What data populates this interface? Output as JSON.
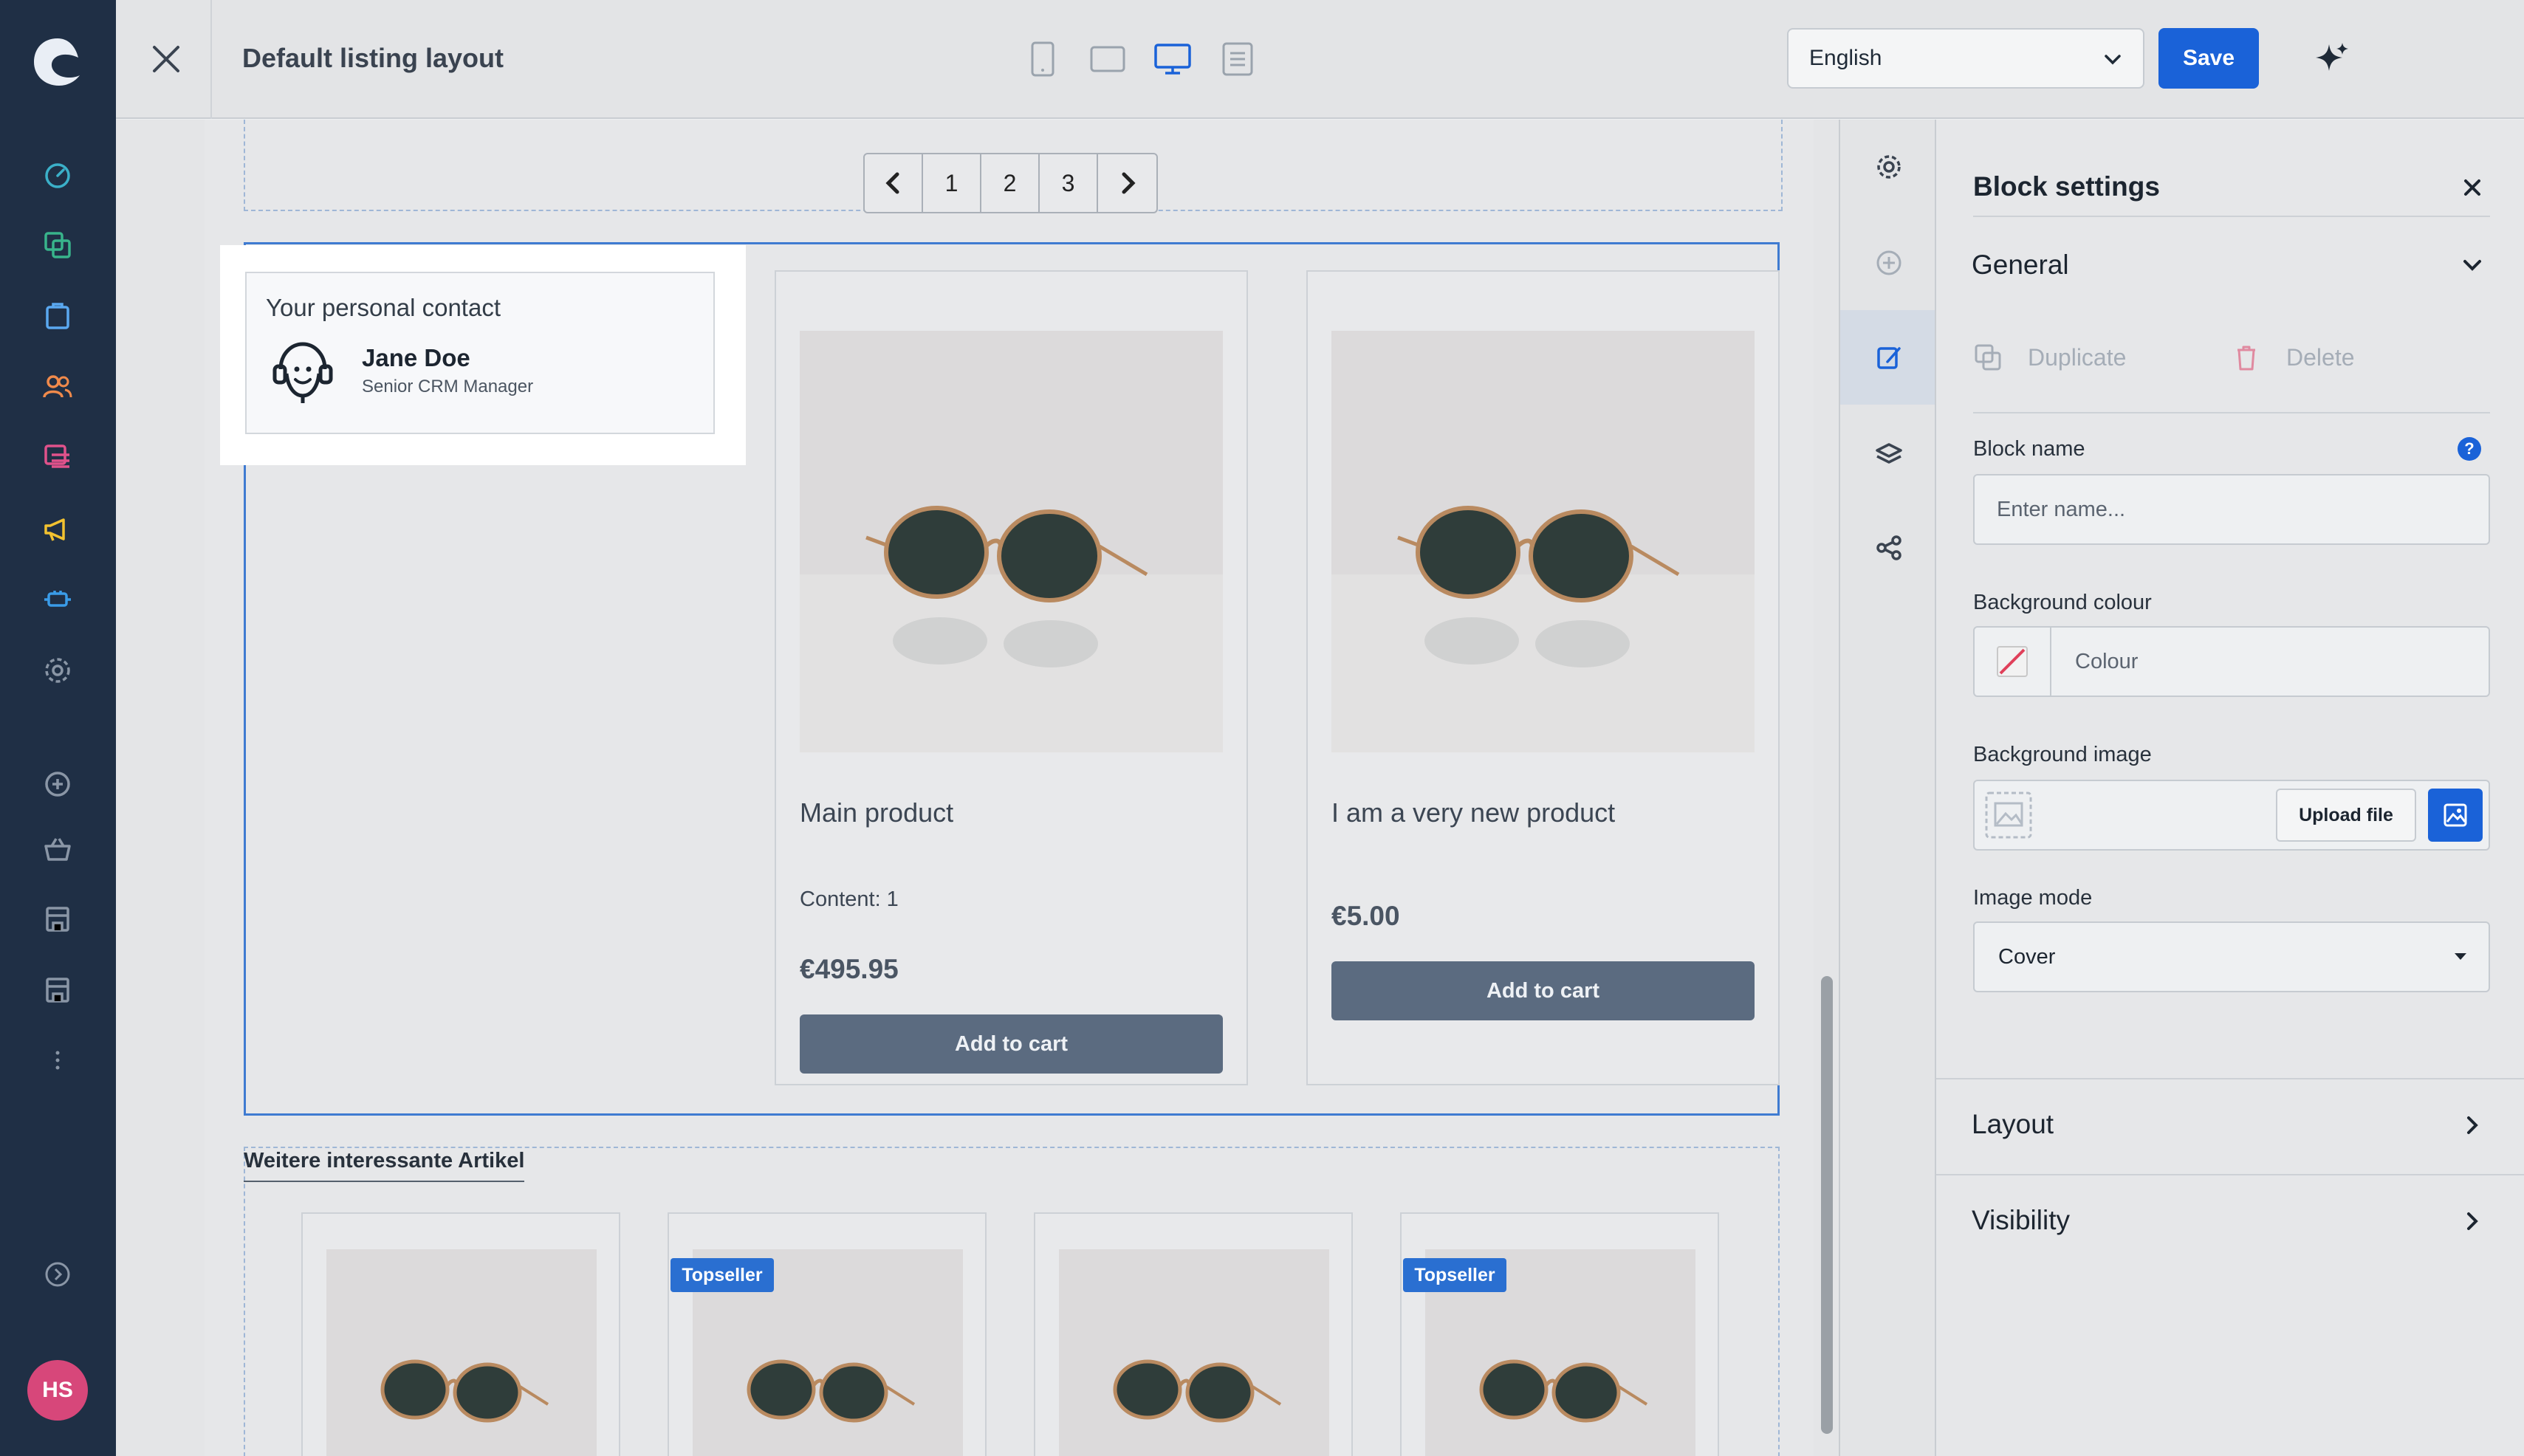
{
  "header": {
    "title": "Default listing layout",
    "language": "English",
    "save_label": "Save"
  },
  "user": {
    "initials": "HS"
  },
  "pagination": {
    "pages": [
      "1",
      "2",
      "3"
    ]
  },
  "contact": {
    "heading": "Your personal contact",
    "name": "Jane Doe",
    "role": "Senior CRM Manager"
  },
  "products": [
    {
      "name": "Main product",
      "content": "Content: 1",
      "price": "€495.95",
      "cart_label": "Add to cart"
    },
    {
      "name": "I am a very new product",
      "content": "",
      "price": "€5.00",
      "cart_label": "Add to cart"
    }
  ],
  "interest": {
    "title": "Weitere interessante Artikel",
    "badge": "Topseller"
  },
  "panel": {
    "title": "Block settings",
    "general": "General",
    "duplicate": "Duplicate",
    "delete": "Delete",
    "block_name_label": "Block name",
    "block_name_placeholder": "Enter name...",
    "bg_colour_label": "Background colour",
    "colour_placeholder": "Colour",
    "bg_image_label": "Background image",
    "upload_label": "Upload file",
    "image_mode_label": "Image mode",
    "image_mode_value": "Cover",
    "layout": "Layout",
    "visibility": "Visibility"
  },
  "colors": {
    "sidebar": "#1f2f45",
    "accent": "#1a62d8",
    "selection_border": "#3f7bd1",
    "avatar": "#d7477a"
  }
}
